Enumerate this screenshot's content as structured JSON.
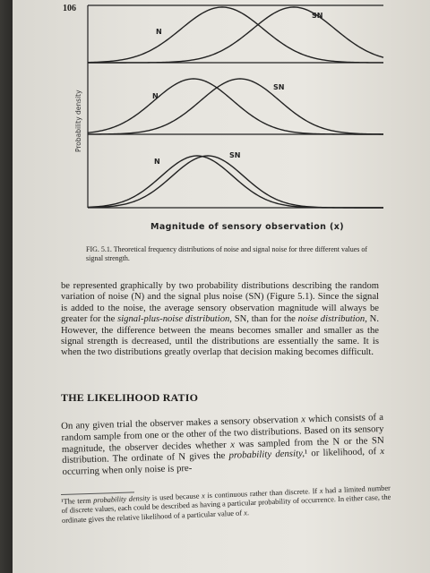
{
  "page": {
    "number": "106"
  },
  "figure": {
    "y_axis_label": "Probability density",
    "x_axis_label": "Magnitude of sensory observation (x)",
    "panels": [
      {
        "noise_label": "N",
        "signal_label": "SN"
      },
      {
        "noise_label": "N",
        "signal_label": "SN"
      },
      {
        "noise_label": "N",
        "signal_label": "SN"
      }
    ],
    "caption": "FIG. 5.1. Theoretical frequency distributions of noise and signal noise for three different values of signal strength."
  },
  "paragraph1": {
    "t1": "be represented graphically by two probability distributions describing the random variation of noise (N) and the signal plus noise (SN) (Figure 5.1). Since the signal is added to the noise, the average sensory observation magnitude will always be greater for the ",
    "t2": "signal-plus-noise distribution",
    "t3": ", SN, than for the ",
    "t4": "noise distribution",
    "t5": ", N. However, the difference between the means becomes smaller and smaller as the signal strength is decreased, until the distributions are essentially the same. It is when the two distributions greatly overlap that decision making becomes difficult."
  },
  "section_heading": "THE LIKELIHOOD RATIO",
  "paragraph2": {
    "t1": "On any given trial the observer makes a sensory observation ",
    "x1": "x",
    "t2": " which consists of a random sample from one or the other of the two distributions. Based on its sensory magnitude, the observer decides whether ",
    "x2": "x",
    "t3": " was sampled from the N or the SN distribution. The ordinate of N gives the ",
    "t4": "probability density,",
    "t5": "¹ or likelihood, of ",
    "x3": "x",
    "t6": " occurring when only noise is pre-"
  },
  "footnote": {
    "t1": "¹The term ",
    "t2": "probability density",
    "t3": " is used because ",
    "x1": "x",
    "t4": " is continuous rather than discrete. If ",
    "x2": "x",
    "t5": " had a limited number of discrete values, each could be described as having a particular probability of occurrence. In either case, the ordinate gives the relative likelihood of a particular value of ",
    "x3": "x",
    "t6": "."
  }
}
